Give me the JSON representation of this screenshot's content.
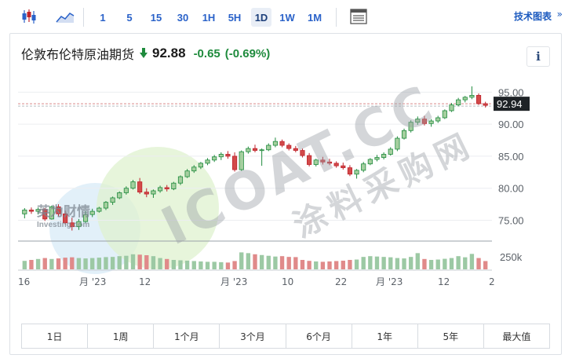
{
  "toolbar": {
    "timeframes": [
      "1",
      "5",
      "15",
      "30",
      "1H",
      "5H",
      "1D",
      "1W",
      "1M"
    ],
    "active_timeframe": "1D",
    "tech_chart_label": "技术图表",
    "tech_chart_arrow": "»"
  },
  "instrument": {
    "name": "伦敦布伦特原油期货",
    "price": "92.88",
    "change": "-0.65",
    "change_pct": "(-0.69%)",
    "direction": "down"
  },
  "info_label": "i",
  "chart_data": {
    "type": "candlestick",
    "ylim": [
      72,
      97
    ],
    "y_ticks": [
      75,
      80,
      85,
      90,
      95
    ],
    "y_tick_labels": [
      "75.00",
      "80.00",
      "85.00",
      "90.00",
      "95.00"
    ],
    "last_price_label": "92.94",
    "last_price": 92.94,
    "x_tick_labels": [
      "16",
      "月 '23",
      "12",
      "月 '23",
      "10",
      "22",
      "月 '23",
      "12",
      "2"
    ],
    "volume_label": "250k",
    "candles": [
      {
        "o": 76.0,
        "h": 76.9,
        "l": 75.3,
        "c": 76.6
      },
      {
        "o": 76.6,
        "h": 77.0,
        "l": 76.0,
        "c": 76.4
      },
      {
        "o": 76.4,
        "h": 77.0,
        "l": 75.9,
        "c": 76.7
      },
      {
        "o": 76.7,
        "h": 76.9,
        "l": 74.9,
        "c": 75.2
      },
      {
        "o": 75.2,
        "h": 77.3,
        "l": 75.1,
        "c": 77.1
      },
      {
        "o": 77.1,
        "h": 77.5,
        "l": 75.6,
        "c": 76.0
      },
      {
        "o": 76.0,
        "h": 76.5,
        "l": 74.3,
        "c": 74.6
      },
      {
        "o": 74.6,
        "h": 75.4,
        "l": 73.4,
        "c": 74.0
      },
      {
        "o": 74.0,
        "h": 75.2,
        "l": 73.5,
        "c": 74.8
      },
      {
        "o": 74.8,
        "h": 76.4,
        "l": 74.6,
        "c": 75.9
      },
      {
        "o": 75.9,
        "h": 76.8,
        "l": 75.5,
        "c": 76.4
      },
      {
        "o": 76.4,
        "h": 77.1,
        "l": 76.2,
        "c": 76.9
      },
      {
        "o": 76.9,
        "h": 78.0,
        "l": 76.6,
        "c": 77.8
      },
      {
        "o": 77.8,
        "h": 78.7,
        "l": 77.4,
        "c": 78.5
      },
      {
        "o": 78.5,
        "h": 79.5,
        "l": 78.3,
        "c": 79.3
      },
      {
        "o": 79.3,
        "h": 80.3,
        "l": 79.0,
        "c": 80.0
      },
      {
        "o": 80.0,
        "h": 81.3,
        "l": 79.8,
        "c": 81.0
      },
      {
        "o": 81.0,
        "h": 81.6,
        "l": 79.1,
        "c": 79.4
      },
      {
        "o": 79.4,
        "h": 80.0,
        "l": 78.6,
        "c": 79.1
      },
      {
        "o": 79.1,
        "h": 79.8,
        "l": 78.5,
        "c": 79.6
      },
      {
        "o": 79.6,
        "h": 80.4,
        "l": 79.3,
        "c": 80.1
      },
      {
        "o": 80.1,
        "h": 80.5,
        "l": 79.5,
        "c": 79.9
      },
      {
        "o": 79.9,
        "h": 81.0,
        "l": 79.7,
        "c": 80.8
      },
      {
        "o": 80.8,
        "h": 82.0,
        "l": 80.5,
        "c": 81.8
      },
      {
        "o": 81.8,
        "h": 83.0,
        "l": 81.6,
        "c": 82.7
      },
      {
        "o": 82.7,
        "h": 83.6,
        "l": 82.4,
        "c": 83.3
      },
      {
        "o": 83.3,
        "h": 84.1,
        "l": 83.0,
        "c": 83.9
      },
      {
        "o": 83.9,
        "h": 84.7,
        "l": 83.6,
        "c": 84.4
      },
      {
        "o": 84.4,
        "h": 85.2,
        "l": 84.1,
        "c": 84.9
      },
      {
        "o": 84.9,
        "h": 85.6,
        "l": 84.4,
        "c": 85.3
      },
      {
        "o": 85.3,
        "h": 85.8,
        "l": 84.6,
        "c": 85.0
      },
      {
        "o": 85.0,
        "h": 85.6,
        "l": 82.6,
        "c": 82.9
      },
      {
        "o": 82.9,
        "h": 85.9,
        "l": 82.7,
        "c": 85.7
      },
      {
        "o": 85.7,
        "h": 86.5,
        "l": 85.4,
        "c": 86.2
      },
      {
        "o": 86.2,
        "h": 86.8,
        "l": 85.6,
        "c": 85.9
      },
      {
        "o": 85.9,
        "h": 86.2,
        "l": 83.5,
        "c": 86.0
      },
      {
        "o": 86.0,
        "h": 87.0,
        "l": 85.8,
        "c": 86.7
      },
      {
        "o": 86.7,
        "h": 87.9,
        "l": 86.4,
        "c": 87.3
      },
      {
        "o": 87.3,
        "h": 87.6,
        "l": 86.4,
        "c": 86.7
      },
      {
        "o": 86.7,
        "h": 87.0,
        "l": 85.9,
        "c": 86.2
      },
      {
        "o": 86.2,
        "h": 86.6,
        "l": 85.6,
        "c": 85.9
      },
      {
        "o": 85.9,
        "h": 86.2,
        "l": 84.8,
        "c": 85.1
      },
      {
        "o": 85.1,
        "h": 85.5,
        "l": 83.4,
        "c": 83.7
      },
      {
        "o": 83.7,
        "h": 84.6,
        "l": 83.4,
        "c": 84.4
      },
      {
        "o": 84.4,
        "h": 84.9,
        "l": 83.7,
        "c": 84.1
      },
      {
        "o": 84.1,
        "h": 84.6,
        "l": 83.6,
        "c": 83.9
      },
      {
        "o": 83.9,
        "h": 84.2,
        "l": 83.2,
        "c": 83.5
      },
      {
        "o": 83.5,
        "h": 84.0,
        "l": 82.9,
        "c": 83.2
      },
      {
        "o": 83.2,
        "h": 83.6,
        "l": 81.9,
        "c": 82.2
      },
      {
        "o": 82.2,
        "h": 83.0,
        "l": 81.5,
        "c": 82.8
      },
      {
        "o": 82.8,
        "h": 84.1,
        "l": 82.5,
        "c": 83.8
      },
      {
        "o": 83.8,
        "h": 84.7,
        "l": 83.6,
        "c": 84.5
      },
      {
        "o": 84.5,
        "h": 85.2,
        "l": 84.2,
        "c": 84.8
      },
      {
        "o": 84.8,
        "h": 85.6,
        "l": 84.5,
        "c": 85.3
      },
      {
        "o": 85.3,
        "h": 86.4,
        "l": 85.1,
        "c": 86.1
      },
      {
        "o": 86.1,
        "h": 88.1,
        "l": 85.8,
        "c": 87.8
      },
      {
        "o": 87.8,
        "h": 89.3,
        "l": 87.6,
        "c": 89.0
      },
      {
        "o": 89.0,
        "h": 90.6,
        "l": 88.7,
        "c": 90.3
      },
      {
        "o": 90.3,
        "h": 91.2,
        "l": 89.9,
        "c": 90.8
      },
      {
        "o": 90.8,
        "h": 91.3,
        "l": 89.8,
        "c": 90.1
      },
      {
        "o": 90.1,
        "h": 90.8,
        "l": 89.6,
        "c": 90.5
      },
      {
        "o": 90.5,
        "h": 91.3,
        "l": 90.2,
        "c": 91.0
      },
      {
        "o": 91.0,
        "h": 92.3,
        "l": 90.8,
        "c": 92.1
      },
      {
        "o": 92.1,
        "h": 93.3,
        "l": 91.9,
        "c": 93.0
      },
      {
        "o": 93.0,
        "h": 94.1,
        "l": 92.8,
        "c": 93.8
      },
      {
        "o": 93.8,
        "h": 94.4,
        "l": 93.4,
        "c": 94.2
      },
      {
        "o": 94.2,
        "h": 95.9,
        "l": 93.9,
        "c": 94.5
      },
      {
        "o": 94.5,
        "h": 94.8,
        "l": 93.0,
        "c": 93.2
      },
      {
        "o": 93.2,
        "h": 93.5,
        "l": 92.6,
        "c": 92.94
      }
    ],
    "volumes": [
      0.45,
      0.5,
      0.55,
      0.6,
      0.55,
      0.58,
      0.62,
      0.64,
      0.6,
      0.58,
      0.6,
      0.62,
      0.65,
      0.66,
      0.7,
      0.72,
      0.8,
      0.78,
      0.75,
      0.7,
      0.6,
      0.55,
      0.5,
      0.48,
      0.46,
      0.44,
      0.42,
      0.4,
      0.4,
      0.38,
      0.36,
      0.44,
      0.9,
      0.86,
      0.8,
      0.76,
      0.72,
      0.68,
      0.7,
      0.66,
      0.65,
      0.5,
      0.45,
      0.42,
      0.4,
      0.42,
      0.44,
      0.46,
      0.5,
      0.52,
      0.66,
      0.7,
      0.68,
      0.66,
      0.64,
      0.6,
      0.58,
      0.66,
      0.86,
      0.55,
      0.5,
      0.52,
      0.56,
      0.6,
      0.7,
      0.64,
      0.82,
      0.6,
      0.44,
      0.38
    ]
  },
  "colors": {
    "up": "#1f8b3d",
    "down": "#c0232c",
    "up_fill": "#a5cf9f",
    "down_fill": "#d24a4a",
    "vol_up": "#9cc9a4",
    "vol_down": "#e08a8a",
    "accent": "#2a62c9"
  },
  "watermark": {
    "text1": "ICOAT.CC",
    "text2": "涂料采购网",
    "logo_cn": "英为财情",
    "logo_en": "Investing.com"
  },
  "ranges": [
    "1日",
    "1周",
    "1个月",
    "3个月",
    "6个月",
    "1年",
    "5年",
    "最大值"
  ]
}
